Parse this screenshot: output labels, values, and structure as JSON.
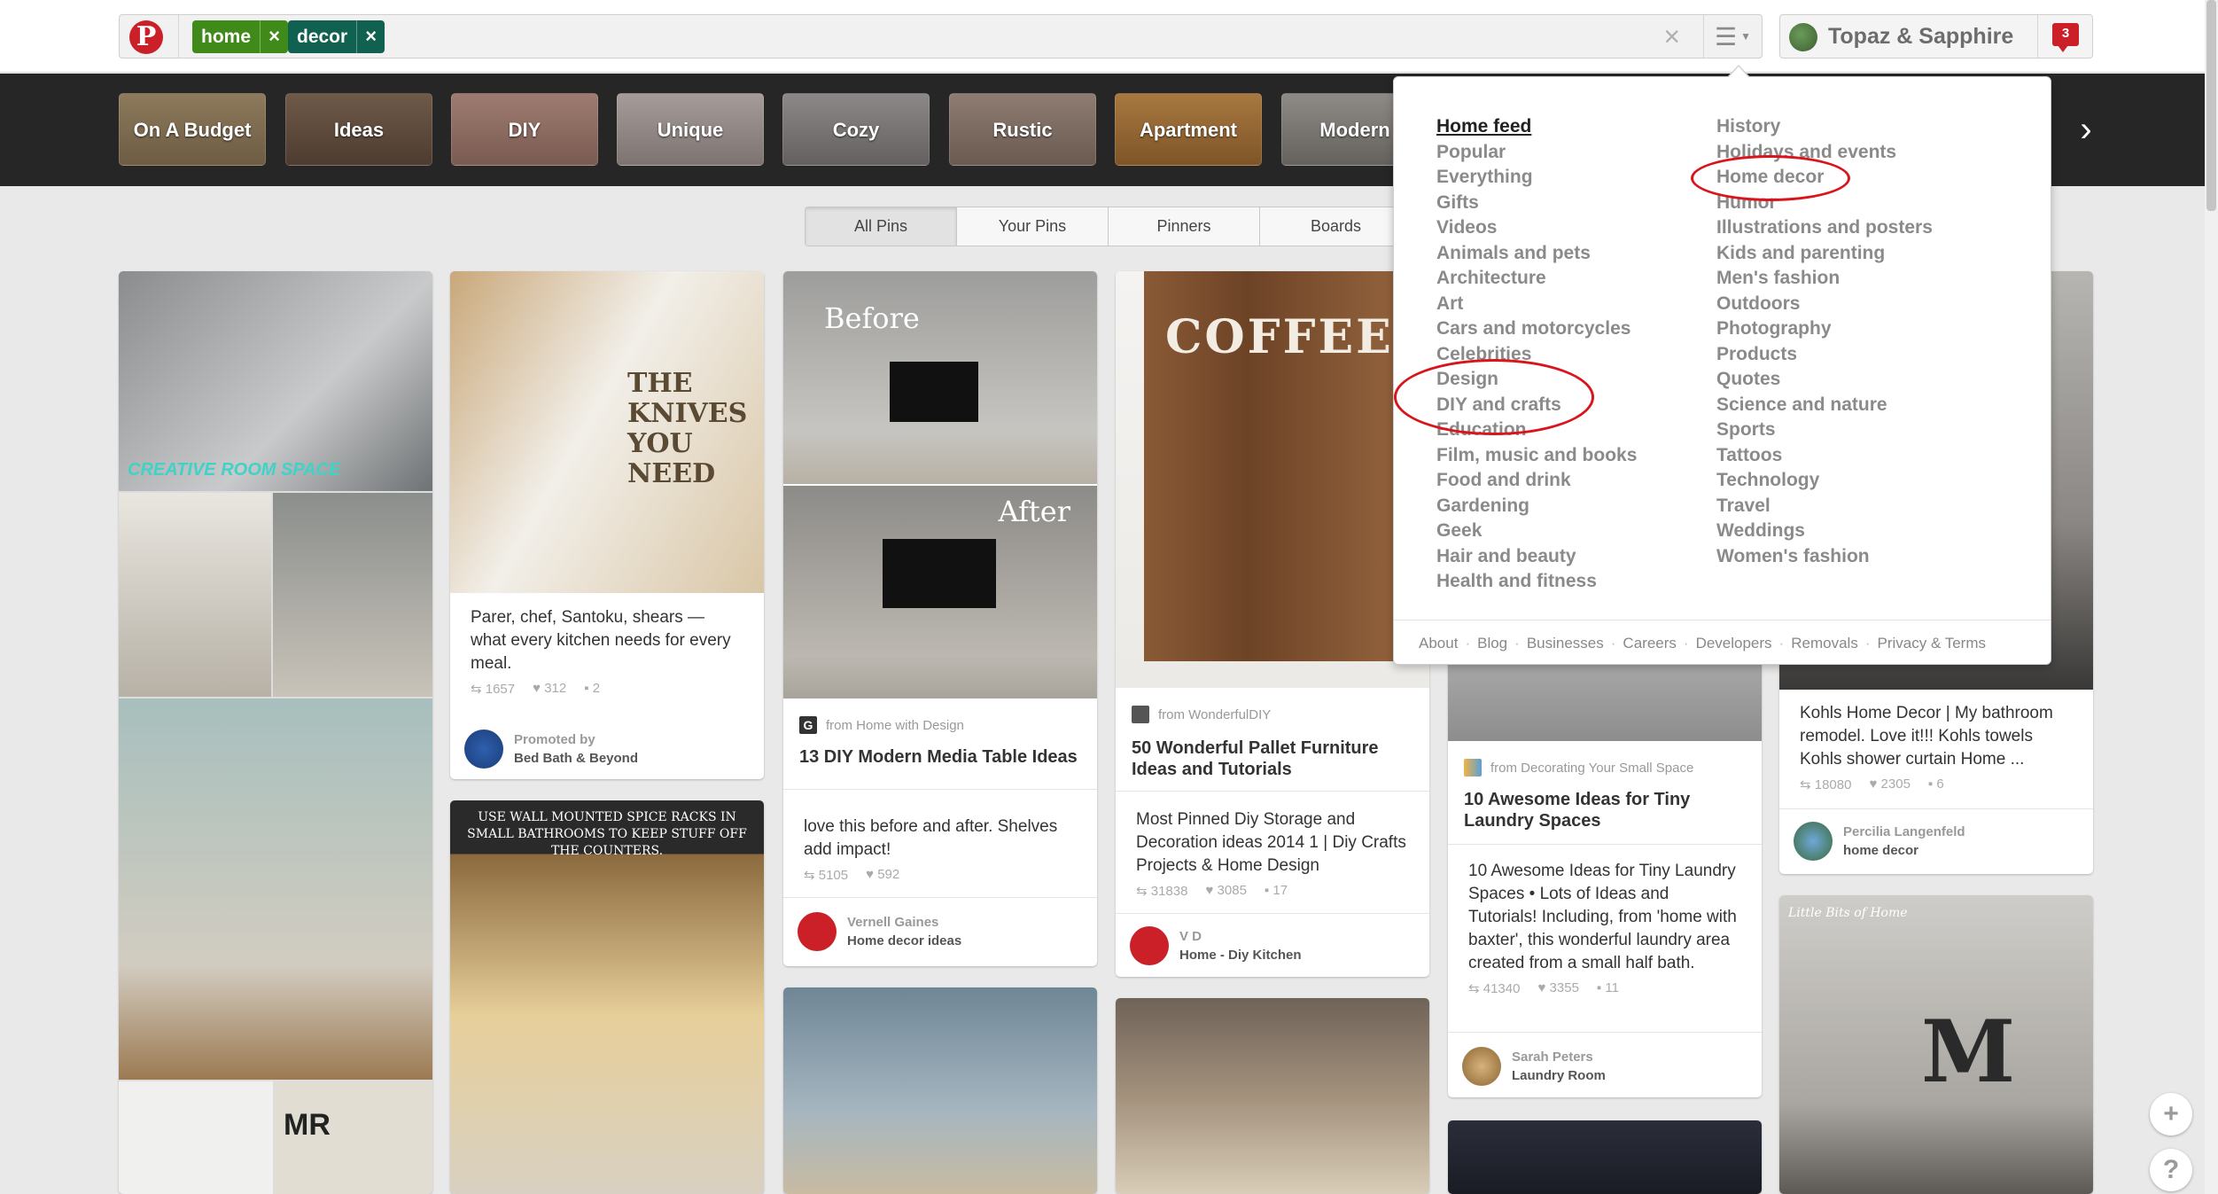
{
  "search": {
    "tokens": [
      {
        "label": "home",
        "color": "#3f8a19"
      },
      {
        "label": "decor",
        "color": "#116150"
      }
    ],
    "clear_glyph": "×",
    "remove_glyph": "×",
    "menu_glyph": "☰",
    "icons": [
      "pinterest-logo-icon",
      "clear-search-icon",
      "category-menu-icon"
    ]
  },
  "user": {
    "name": "Topaz & Sapphire",
    "notifications": "3"
  },
  "categories": [
    "On A Budget",
    "Ideas",
    "DIY",
    "Unique",
    "Cozy",
    "Rustic",
    "Apartment",
    "Modern"
  ],
  "category_next_glyph": "›",
  "scope_tabs": [
    "All Pins",
    "Your Pins",
    "Pinners",
    "Boards"
  ],
  "menu": {
    "left_column": [
      "Home feed",
      "Popular",
      "Everything",
      "Gifts",
      "Videos",
      "Animals and pets",
      "Architecture",
      "Art",
      "Cars and motorcycles",
      "Celebrities",
      "Design",
      "DIY and crafts",
      "Education",
      "Film, music and books",
      "Food and drink",
      "Gardening",
      "Geek",
      "Hair and beauty",
      "Health and fitness"
    ],
    "right_column": [
      "History",
      "Holidays and events",
      "Home decor",
      "Humor",
      "Illustrations and posters",
      "Kids and parenting",
      "Men's fashion",
      "Outdoors",
      "Photography",
      "Products",
      "Quotes",
      "Science and nature",
      "Sports",
      "Tattoos",
      "Technology",
      "Travel",
      "Weddings",
      "Women's fashion"
    ],
    "footer_links": [
      "About",
      "Blog",
      "Businesses",
      "Careers",
      "Developers",
      "Removals",
      "Privacy & Terms"
    ],
    "annotation_color": "#d9141b"
  },
  "pins": {
    "knives": {
      "description": "Parer, chef, Santoku, shears — what every kitchen needs for every meal.",
      "repins": "1657",
      "likes": "312",
      "comments": "2",
      "footer_top": "Promoted by",
      "footer_bottom": "Bed Bath & Beyond"
    },
    "media_table": {
      "source": "from Home with Design",
      "title": "13 DIY Modern Media Table Ideas",
      "description": "love this before and after. Shelves add impact!",
      "repins": "5105",
      "likes": "592",
      "footer_top": "Vernell Gaines",
      "footer_bottom": "Home decor ideas",
      "image_text_before": "Before",
      "image_text_after": "After"
    },
    "pallet": {
      "source": "from WonderfulDIY",
      "title": "50 Wonderful Pallet Furniture Ideas and Tutorials",
      "description": "Most Pinned Diy Storage and Decoration ideas 2014 1 | Diy Crafts Projects & Home Design",
      "repins": "31838",
      "likes": "3085",
      "comments": "17",
      "footer_top": "V D",
      "footer_bottom": "Home - Diy Kitchen",
      "image_text": "COFFEE"
    },
    "laundry": {
      "source": "from Decorating Your Small Space",
      "title": "10 Awesome Ideas for Tiny Laundry Spaces",
      "description": "10 Awesome Ideas for Tiny Laundry Spaces • Lots of Ideas and Tutorials! Including, from 'home with baxter', this wonderful laundry area created from a small half bath.",
      "repins": "41340",
      "likes": "3355",
      "comments": "11",
      "footer_top": "Sarah Peters",
      "footer_bottom": "Laundry Room"
    },
    "bathroom": {
      "description": "Kohls Home Decor | My bathroom remodel. Love it!!! Kohls towels Kohls shower curtain Home ...",
      "repins": "18080",
      "likes": "2305",
      "comments": "6",
      "footer_top": "Percilia Langenfeld",
      "footer_bottom": "home decor"
    },
    "spice": {
      "image_text": "USE WALL MOUNTED SPICE RACKS IN SMALL BATHROOMS TO KEEP STUFF OFF THE COUNTERS."
    },
    "gallery": {
      "image_text": "Little Bits of Home",
      "letter": "M"
    },
    "collage": {
      "image_text": "CREATIVE ROOM SPACE",
      "letters": "MR"
    },
    "knives_image_text": "THE KNIVES YOU NEED"
  },
  "float_buttons": {
    "add": "+",
    "help": "?"
  }
}
